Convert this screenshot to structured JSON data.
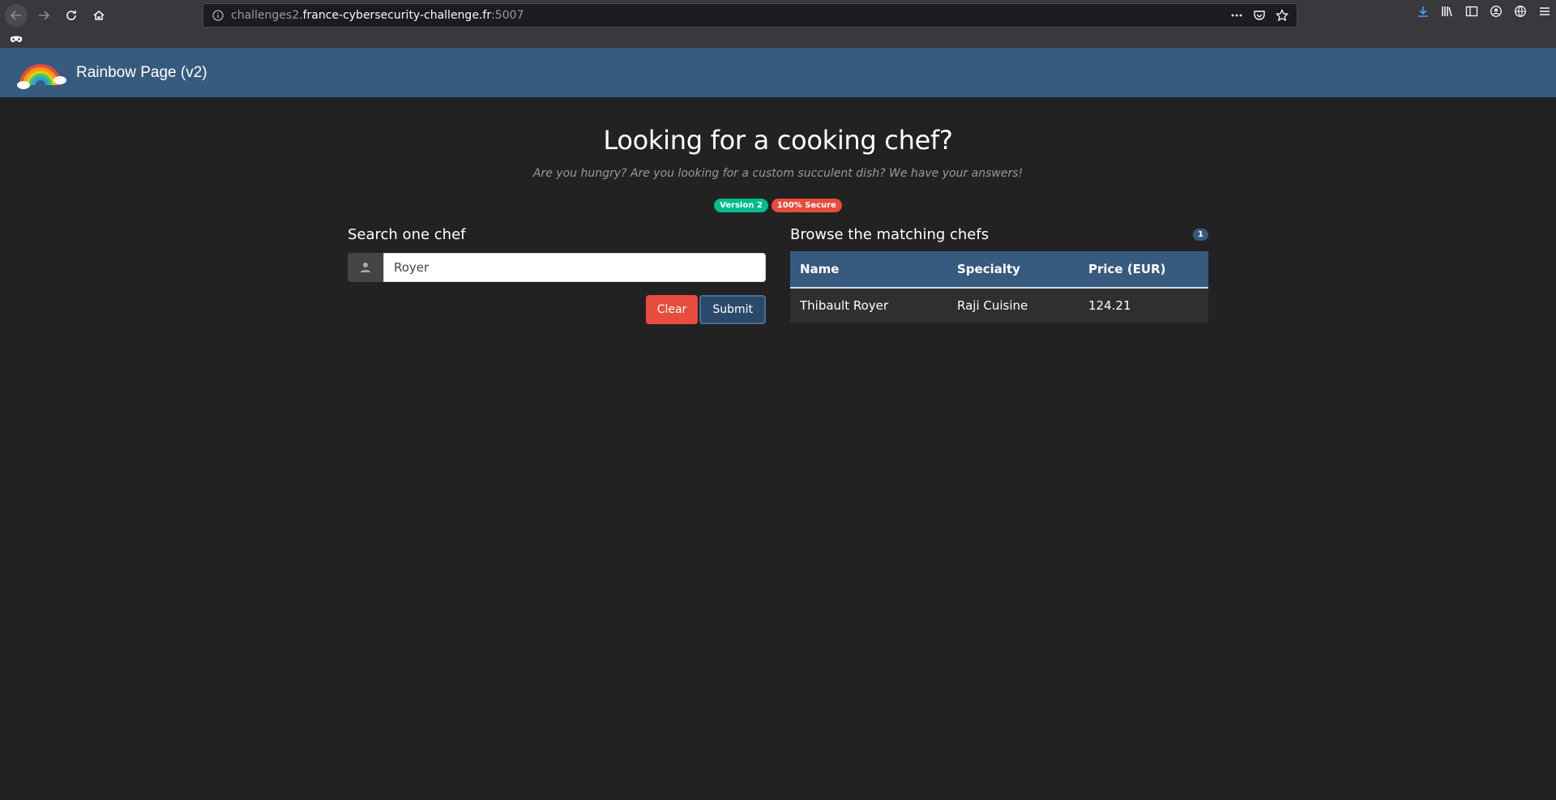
{
  "browser": {
    "url_prefix": "challenges2.",
    "url_host": "france-cybersecurity-challenge.fr",
    "url_port": ":5007"
  },
  "navbar": {
    "brand": "Rainbow Page (v2)"
  },
  "hero": {
    "title": "Looking for a cooking chef?",
    "subtitle": "Are you hungry? Are you looking for a custom succulent dish? We have your answers!",
    "badges": [
      "Version 2",
      "100% Secure"
    ]
  },
  "search": {
    "title": "Search one chef",
    "value": "Royer",
    "clear_label": "Clear",
    "submit_label": "Submit"
  },
  "results": {
    "title": "Browse the matching chefs",
    "count": "1",
    "columns": [
      "Name",
      "Specialty",
      "Price (EUR)"
    ],
    "rows": [
      [
        "Thibault Royer",
        "Raji Cuisine",
        "124.21"
      ]
    ]
  },
  "colors": {
    "navbar": "#375a7f",
    "background": "#222222",
    "success": "#00bc8c",
    "danger": "#e74c3c"
  },
  "icons": [
    "back-icon",
    "forward-icon",
    "reload-icon",
    "home-icon",
    "info-icon",
    "more-icon",
    "pocket-icon",
    "bookmark-star-icon",
    "download-icon",
    "library-icon",
    "sidebar-icon",
    "account-icon",
    "globe-icon",
    "menu-icon",
    "private-mask-icon",
    "rainbow-logo",
    "user-icon"
  ]
}
